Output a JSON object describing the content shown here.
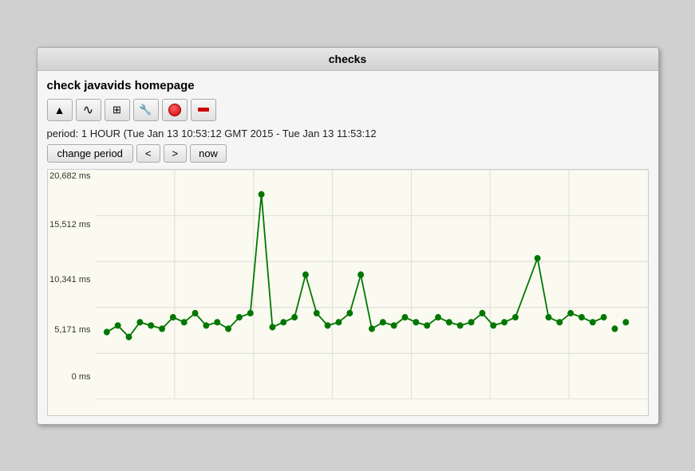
{
  "window": {
    "title": "checks"
  },
  "header": {
    "check_name": "check javavids homepage"
  },
  "toolbar": {
    "buttons": [
      {
        "id": "up",
        "icon": "▲",
        "label": "up-arrow"
      },
      {
        "id": "chart",
        "icon": "∿",
        "label": "chart"
      },
      {
        "id": "list",
        "icon": "⊞",
        "label": "list"
      },
      {
        "id": "wrench",
        "icon": "🔧",
        "label": "settings"
      },
      {
        "id": "record",
        "icon": "circle",
        "label": "record"
      },
      {
        "id": "minus",
        "icon": "minus",
        "label": "delete"
      }
    ]
  },
  "period": {
    "text": "period: 1 HOUR (Tue Jan 13 10:53:12 GMT 2015 - Tue Jan 13 11:53:12"
  },
  "nav": {
    "change_period": "change period",
    "prev": "<",
    "next": ">",
    "now": "now"
  },
  "chart": {
    "y_labels": [
      "20,682 ms",
      "15,512 ms",
      "10,341 ms",
      "5,171 ms",
      "0 ms"
    ],
    "y_positions": [
      0,
      25,
      50,
      75,
      100
    ],
    "color": "#007700",
    "data_points": [
      {
        "x": 2,
        "y": 78
      },
      {
        "x": 4,
        "y": 74
      },
      {
        "x": 6,
        "y": 80
      },
      {
        "x": 8,
        "y": 72
      },
      {
        "x": 10,
        "y": 74
      },
      {
        "x": 12,
        "y": 76
      },
      {
        "x": 14,
        "y": 70
      },
      {
        "x": 16,
        "y": 72
      },
      {
        "x": 18,
        "y": 68
      },
      {
        "x": 20,
        "y": 74
      },
      {
        "x": 22,
        "y": 72
      },
      {
        "x": 24,
        "y": 76
      },
      {
        "x": 26,
        "y": 70
      },
      {
        "x": 28,
        "y": 68
      },
      {
        "x": 30,
        "y": 12
      },
      {
        "x": 32,
        "y": 75
      },
      {
        "x": 34,
        "y": 72
      },
      {
        "x": 36,
        "y": 70
      },
      {
        "x": 38,
        "y": 50
      },
      {
        "x": 40,
        "y": 68
      },
      {
        "x": 42,
        "y": 74
      },
      {
        "x": 44,
        "y": 72
      },
      {
        "x": 46,
        "y": 68
      },
      {
        "x": 48,
        "y": 50
      },
      {
        "x": 50,
        "y": 76
      },
      {
        "x": 52,
        "y": 72
      },
      {
        "x": 54,
        "y": 74
      },
      {
        "x": 56,
        "y": 70
      },
      {
        "x": 58,
        "y": 72
      },
      {
        "x": 60,
        "y": 74
      },
      {
        "x": 62,
        "y": 70
      },
      {
        "x": 64,
        "y": 72
      },
      {
        "x": 66,
        "y": 74
      },
      {
        "x": 68,
        "y": 72
      },
      {
        "x": 70,
        "y": 68
      },
      {
        "x": 72,
        "y": 74
      },
      {
        "x": 74,
        "y": 72
      },
      {
        "x": 76,
        "y": 70
      },
      {
        "x": 80,
        "y": 42
      },
      {
        "x": 82,
        "y": 70
      },
      {
        "x": 86,
        "y": 72
      },
      {
        "x": 90,
        "y": 68
      },
      {
        "x": 92,
        "y": 72
      },
      {
        "x": 94,
        "y": 70
      },
      {
        "x": 96,
        "y": 72
      }
    ]
  }
}
